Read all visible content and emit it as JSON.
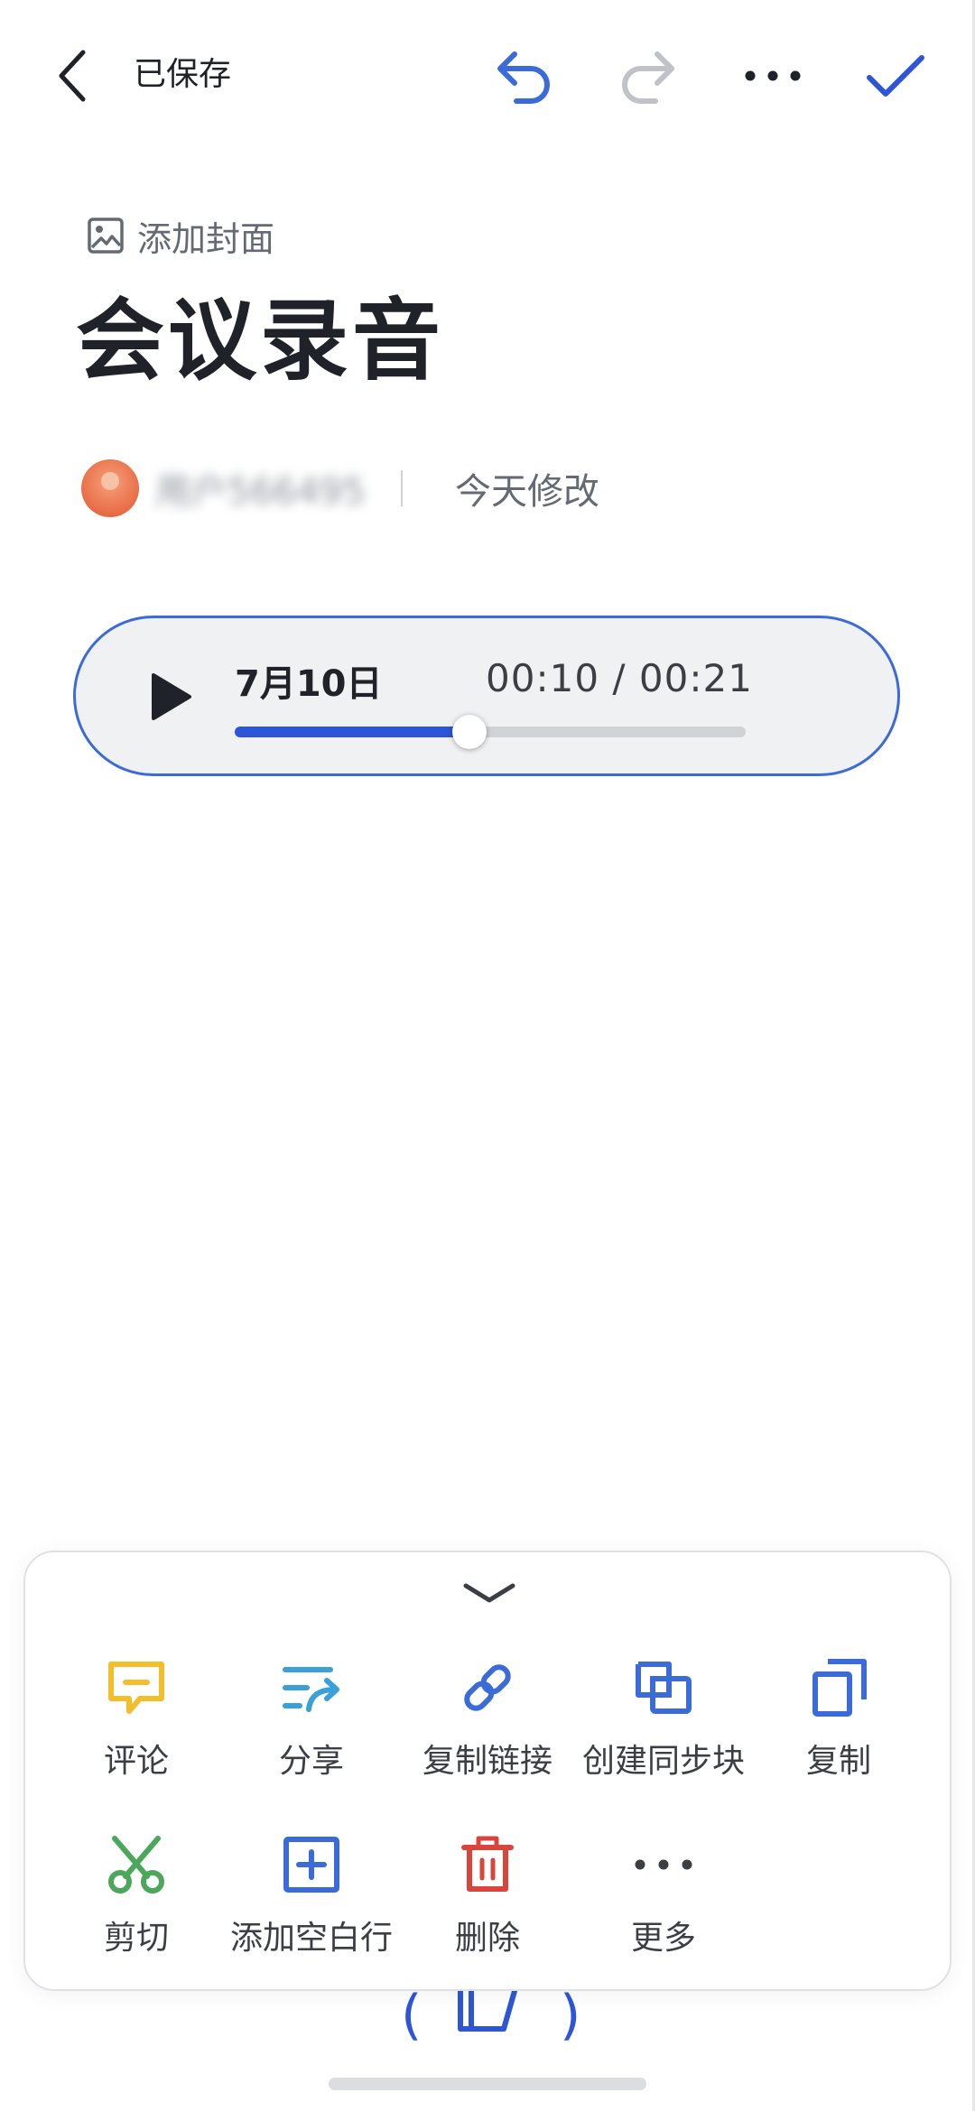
{
  "topbar": {
    "saved_label": "已保存",
    "icons": [
      "back-chevron",
      "undo-arrow",
      "redo-arrow",
      "more-dots",
      "done-check"
    ],
    "colors": {
      "undo": "#3b6ad9",
      "redo": "#bfc2c7",
      "done": "#2d55d8"
    }
  },
  "doc": {
    "add_cover": "添加封面",
    "title": "会议录音",
    "author": "用户566495",
    "modified": "今天修改"
  },
  "audio": {
    "date": "7月10日",
    "time": "00:10 / 00:21",
    "progress": 0.46,
    "accent": "#2d55d8"
  },
  "actions": {
    "row1": [
      {
        "label": "评论",
        "icon": "comment-icon",
        "color": "#f2be2b"
      },
      {
        "label": "分享",
        "icon": "share-icon",
        "color": "#3aa0d8"
      },
      {
        "label": "复制链接",
        "icon": "link-icon",
        "color": "#3b6ad9"
      },
      {
        "label": "创建同步块",
        "icon": "sync-block-icon",
        "color": "#3b6ad9"
      },
      {
        "label": "复制",
        "icon": "copy-icon",
        "color": "#3b6ad9"
      }
    ],
    "row2": [
      {
        "label": "剪切",
        "icon": "scissors-icon",
        "color": "#4ca75a"
      },
      {
        "label": "添加空白行",
        "icon": "add-line-icon",
        "color": "#3b6ad9"
      },
      {
        "label": "删除",
        "icon": "trash-icon",
        "color": "#d9453b"
      },
      {
        "label": "更多",
        "icon": "more-dots-icon",
        "color": "#3b3f45"
      }
    ]
  }
}
